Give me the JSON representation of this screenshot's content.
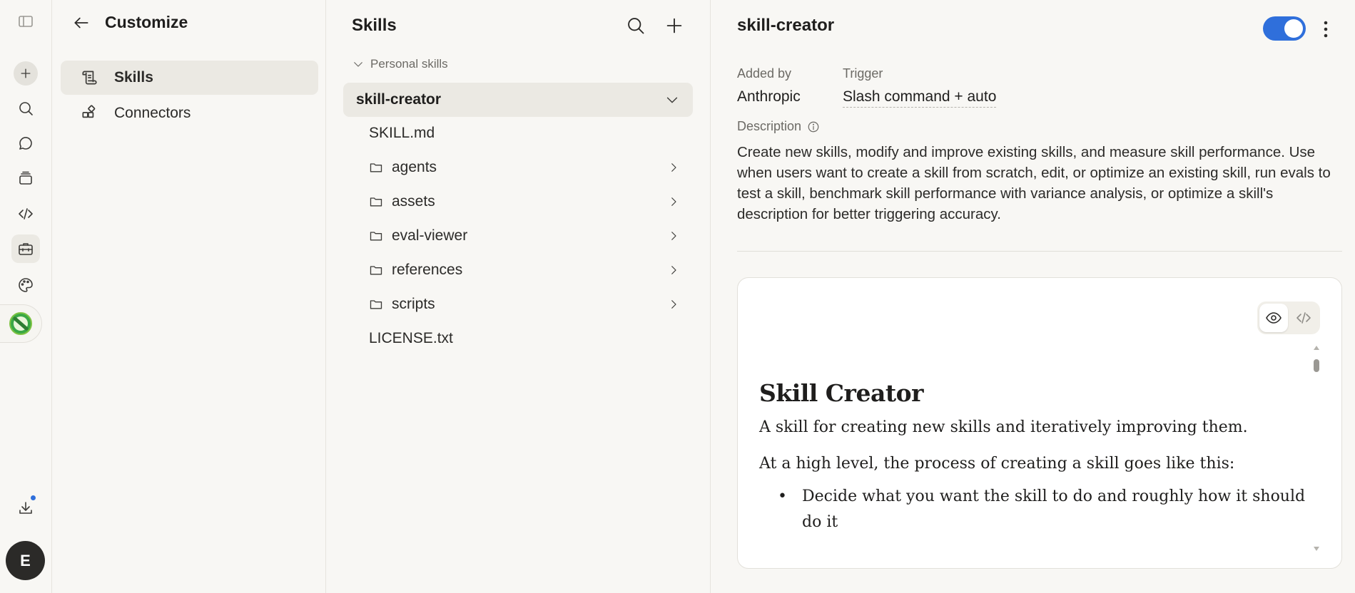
{
  "rail": {
    "items": [
      {
        "name": "sidebar-toggle-icon"
      },
      {
        "name": "new-chat-icon"
      },
      {
        "name": "search-icon"
      },
      {
        "name": "chats-icon"
      },
      {
        "name": "projects-icon"
      },
      {
        "name": "code-icon"
      },
      {
        "name": "customize-icon"
      },
      {
        "name": "palette-icon"
      }
    ],
    "avatar_initial": "E"
  },
  "customize": {
    "title": "Customize",
    "nav": [
      {
        "label": "Skills",
        "selected": true
      },
      {
        "label": "Connectors",
        "selected": false
      }
    ]
  },
  "skills": {
    "title": "Skills",
    "group_label": "Personal skills",
    "selected_skill": "skill-creator",
    "files": [
      {
        "name": "SKILL.md",
        "folder": false
      },
      {
        "name": "agents",
        "folder": true
      },
      {
        "name": "assets",
        "folder": true
      },
      {
        "name": "eval-viewer",
        "folder": true
      },
      {
        "name": "references",
        "folder": true
      },
      {
        "name": "scripts",
        "folder": true
      },
      {
        "name": "LICENSE.txt",
        "folder": false
      }
    ]
  },
  "detail": {
    "title": "skill-creator",
    "enabled": true,
    "added_by_label": "Added by",
    "added_by_value": "Anthropic",
    "trigger_label": "Trigger",
    "trigger_value": "Slash command + auto",
    "description_label": "Description",
    "description": "Create new skills, modify and improve existing skills, and measure skill performance. Use when users want to create a skill from scratch, edit, or optimize an existing skill, run evals to test a skill, benchmark skill performance with variance analysis, or optimize a skill's description for better triggering accuracy.",
    "document": {
      "heading": "Skill Creator",
      "intro": "A skill for creating new skills and iteratively improving them.",
      "lead": "At a high level, the process of creating a skill goes like this:",
      "bullets": [
        "Decide what you want the skill to do and roughly how it should do it"
      ]
    }
  },
  "colors": {
    "accent": "#2f6fdb",
    "background": "#f8f7f4",
    "selected": "#ebe9e3"
  }
}
